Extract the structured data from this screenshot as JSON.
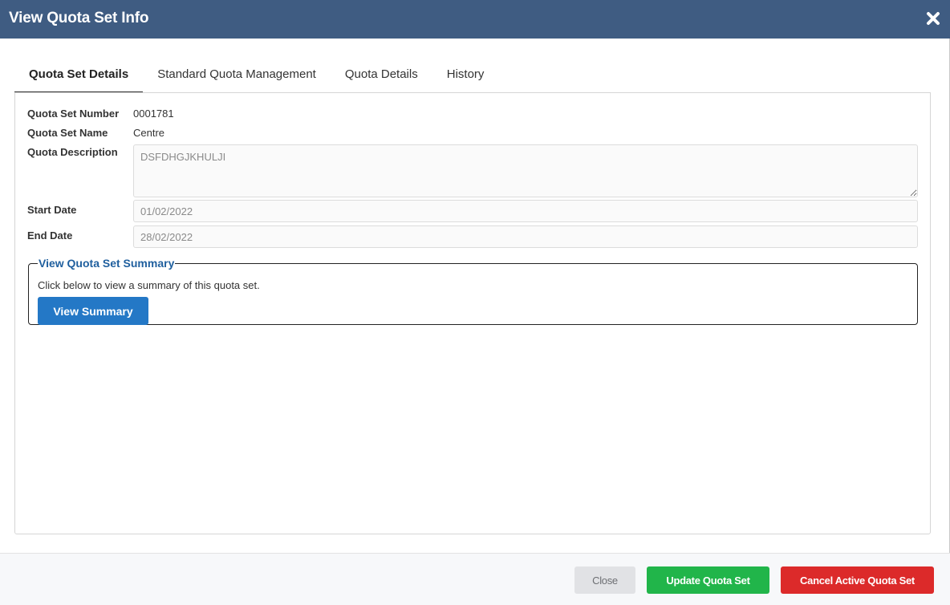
{
  "dialog": {
    "title": "View Quota Set Info",
    "close_icon": "close-x-icon"
  },
  "tabs": [
    {
      "label": "Quota Set Details",
      "active": true
    },
    {
      "label": "Standard Quota Management",
      "active": false
    },
    {
      "label": "Quota Details",
      "active": false
    },
    {
      "label": "History",
      "active": false
    }
  ],
  "details": {
    "number_label": "Quota Set Number",
    "number_value": "0001781",
    "name_label": "Quota Set Name",
    "name_value": "Centre",
    "description_label": "Quota Description",
    "description_value": "DSFDHGJKHULJI",
    "start_label": "Start Date",
    "start_value": "01/02/2022",
    "end_label": "End Date",
    "end_value": "28/02/2022"
  },
  "summary": {
    "legend": "View Quota Set Summary",
    "text": "Click below to view a summary of this quota set.",
    "button": "View Summary"
  },
  "footer": {
    "close": "Close",
    "update": "Update Quota Set",
    "cancel": "Cancel Active Quota Set"
  },
  "colors": {
    "header": "#3f5c82",
    "primary": "#2478c6",
    "success": "#21b54a",
    "danger": "#dc2a2a"
  }
}
